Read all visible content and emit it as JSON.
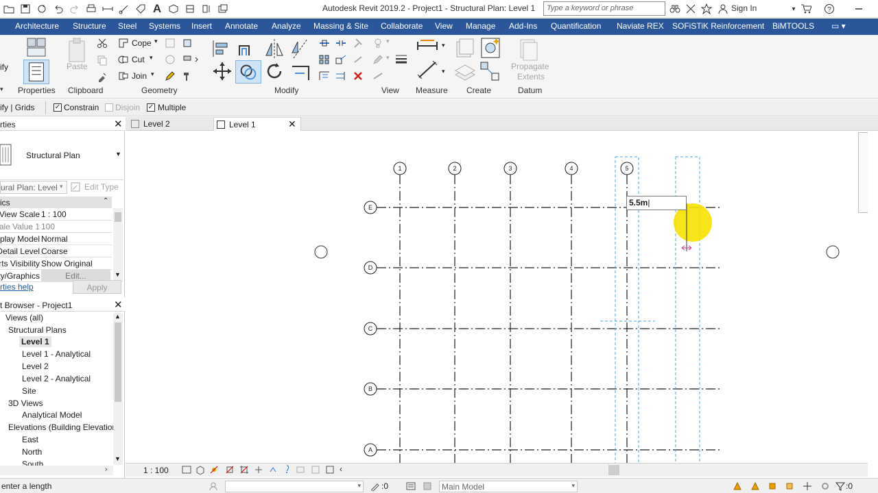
{
  "titlebar": {
    "title": "Autodesk Revit 2019.2 - Project1 - Structural Plan: Level 1",
    "search_placeholder": "Type a keyword or phrase",
    "sign_in": "Sign In"
  },
  "ribbon_tabs": [
    "Architecture",
    "Structure",
    "Steel",
    "Systems",
    "Insert",
    "Annotate",
    "Analyze",
    "Massing & Site",
    "Collaborate",
    "View",
    "Manage",
    "Add-Ins",
    "Quantification",
    "Naviate REX",
    "SOFiSTiK Reinforcement",
    "BiMTOOLS"
  ],
  "ribbon": {
    "modify_partial": "ify",
    "properties_label": "Properties",
    "paste": "Paste",
    "clipboard_label": "Clipboard",
    "cope": "Cope",
    "cut": "Cut",
    "join": "Join",
    "geometry_label": "Geometry",
    "modify_label": "Modify",
    "view_label": "View",
    "measure_label": "Measure",
    "create_label": "Create",
    "propagate_extents_1": "Propagate",
    "propagate_extents_2": "Extents",
    "datum_label": "Datum"
  },
  "options_bar": {
    "context": "ify | Grids",
    "constrain": "Constrain",
    "constrain_checked": true,
    "disjoin": "Disjoin",
    "disjoin_checked": false,
    "multiple": "Multiple",
    "multiple_checked": true
  },
  "properties": {
    "header": "rties",
    "type_name": "Structural Plan",
    "selector": "ural Plan: Level",
    "edit_type": "Edit Type",
    "section": "ics",
    "rows": [
      {
        "key": "View Scale",
        "value": "1 : 100"
      },
      {
        "key": "Scale Value   1:",
        "value": "100"
      },
      {
        "key": "Display Model",
        "value": "Normal"
      },
      {
        "key": "Detail Level",
        "value": "Coarse"
      },
      {
        "key": "Parts Visibility",
        "value": "Show Original"
      },
      {
        "key": "Visibility/Graphics",
        "value": "Edit..."
      }
    ],
    "help": "rties help",
    "apply": "Apply"
  },
  "project_browser": {
    "title": "t Browser - Project1",
    "items": [
      {
        "label": "Views (all)",
        "level": 0
      },
      {
        "label": "Structural Plans",
        "level": 1
      },
      {
        "label": "Level 1",
        "level": 2,
        "bold": true
      },
      {
        "label": "Level 1 - Analytical",
        "level": 2
      },
      {
        "label": "Level 2",
        "level": 2
      },
      {
        "label": "Level 2 - Analytical",
        "level": 2
      },
      {
        "label": "Site",
        "level": 2
      },
      {
        "label": "3D Views",
        "level": 1
      },
      {
        "label": "Analytical Model",
        "level": 2
      },
      {
        "label": "Elevations (Building Elevation",
        "level": 1
      },
      {
        "label": "East",
        "level": 2
      },
      {
        "label": "North",
        "level": 2
      },
      {
        "label": "South",
        "level": 2
      }
    ]
  },
  "view_tabs": [
    {
      "label": "Level 2",
      "active": false
    },
    {
      "label": "Level 1",
      "active": true
    }
  ],
  "canvas": {
    "vertical_grids": [
      "1",
      "2",
      "3",
      "4",
      "5"
    ],
    "horizontal_grids": [
      "E",
      "D",
      "C",
      "B",
      "A"
    ],
    "dimension_input": "5.5m"
  },
  "view_control": {
    "scale": "1 : 100"
  },
  "status": {
    "prompt": "enter a length",
    "count": ":0",
    "model": "Main Model",
    "filter_count": ":0"
  },
  "colors": {
    "tab_bar": "#2b579a",
    "grid_line": "#1a1a1a",
    "temp_dim": "#4aa3d8",
    "cursor_highlight": "#f7e200"
  }
}
